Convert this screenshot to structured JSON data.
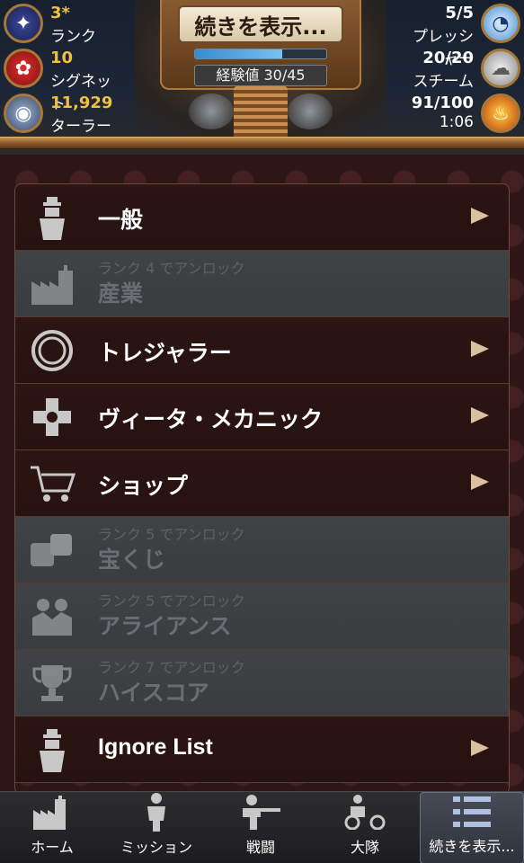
{
  "header": {
    "machine_title": "続きを表示...",
    "xp_label": "経験値 30/45",
    "xp_progress": 0.667,
    "stats_left": [
      {
        "value": "3*",
        "label": "ランク",
        "icon": "rank-badge-icon"
      },
      {
        "value": "10",
        "label": "シグネット",
        "icon": "signet-seal-icon"
      },
      {
        "value": "11,929",
        "label": "ターラー",
        "icon": "thaler-coin-icon"
      }
    ],
    "stats_right": [
      {
        "value": "5/5",
        "label": "プレッシャー",
        "icon": "pressure-gauge-icon"
      },
      {
        "value": "20/20",
        "label": "スチーム",
        "icon": "steam-icon"
      },
      {
        "value": "91/100",
        "label": "1:06",
        "icon": "fire-icon"
      }
    ]
  },
  "menu": {
    "items": [
      {
        "label": "一般",
        "unlock_text": "",
        "locked": false,
        "icon": "gentleman-icon"
      },
      {
        "label": "産業",
        "unlock_text": "ランク 4 でアンロック",
        "locked": true,
        "icon": "factory-icon"
      },
      {
        "label": "トレジャラー",
        "unlock_text": "",
        "locked": false,
        "icon": "porthole-icon"
      },
      {
        "label": "ヴィータ・メカニック",
        "unlock_text": "",
        "locked": false,
        "icon": "medical-cross-icon"
      },
      {
        "label": "ショップ",
        "unlock_text": "",
        "locked": false,
        "icon": "shopping-cart-icon"
      },
      {
        "label": "宝くじ",
        "unlock_text": "ランク 5 でアンロック",
        "locked": true,
        "icon": "dice-icon"
      },
      {
        "label": "アライアンス",
        "unlock_text": "ランク 5 でアンロック",
        "locked": true,
        "icon": "alliance-icon"
      },
      {
        "label": "ハイスコア",
        "unlock_text": "ランク 7 でアンロック",
        "locked": true,
        "icon": "trophy-icon"
      },
      {
        "label": "Ignore List",
        "unlock_text": "",
        "locked": false,
        "icon": "gentleman-icon"
      }
    ]
  },
  "bottom_nav": {
    "items": [
      {
        "label": "ホーム",
        "icon": "home-factory-icon"
      },
      {
        "label": "ミッション",
        "icon": "mission-soldier-icon"
      },
      {
        "label": "戦闘",
        "icon": "battle-rifleman-icon"
      },
      {
        "label": "大隊",
        "icon": "battalion-biker-icon"
      },
      {
        "label": "続きを表示...",
        "icon": "more-list-icon"
      }
    ],
    "active_index": 4
  }
}
